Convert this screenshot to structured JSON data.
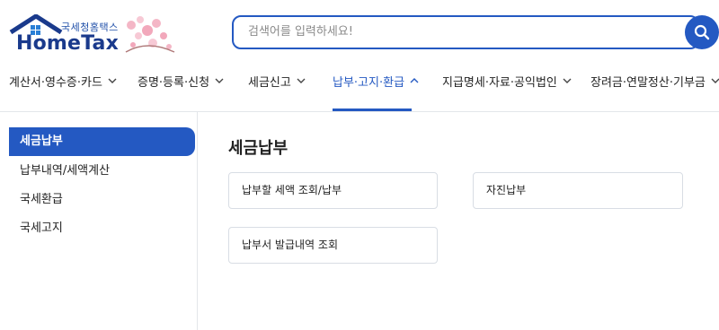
{
  "header": {
    "logo_small": "국세청홈택스",
    "logo_big": "HomeTax",
    "search_placeholder": "검색어를 입력하세요!"
  },
  "nav": {
    "items": [
      {
        "label": "계산서·영수증·카드"
      },
      {
        "label": "증명·등록·신청"
      },
      {
        "label": "세금신고"
      },
      {
        "label": "납부·고지·환급",
        "active": true
      },
      {
        "label": "지급명세·자료·공익법인"
      },
      {
        "label": "장려금·연말정산·기부금"
      }
    ]
  },
  "sidebar": {
    "items": [
      {
        "label": "세금납부",
        "active": true
      },
      {
        "label": "납부내역/세액계산"
      },
      {
        "label": "국세환급"
      },
      {
        "label": "국세고지"
      }
    ]
  },
  "main": {
    "title": "세금납부",
    "cards": [
      {
        "label": "납부할 세액 조회/납부"
      },
      {
        "label": "자진납부"
      },
      {
        "label": "납부서 발급내역 조회"
      }
    ]
  },
  "colors": {
    "accent": "#2459c2",
    "logo": "#1a3a8c",
    "border": "#d8dde4"
  },
  "icons": {
    "search": "search-icon",
    "chevron_down": "chevron-down-icon",
    "chevron_up": "chevron-up-icon"
  }
}
